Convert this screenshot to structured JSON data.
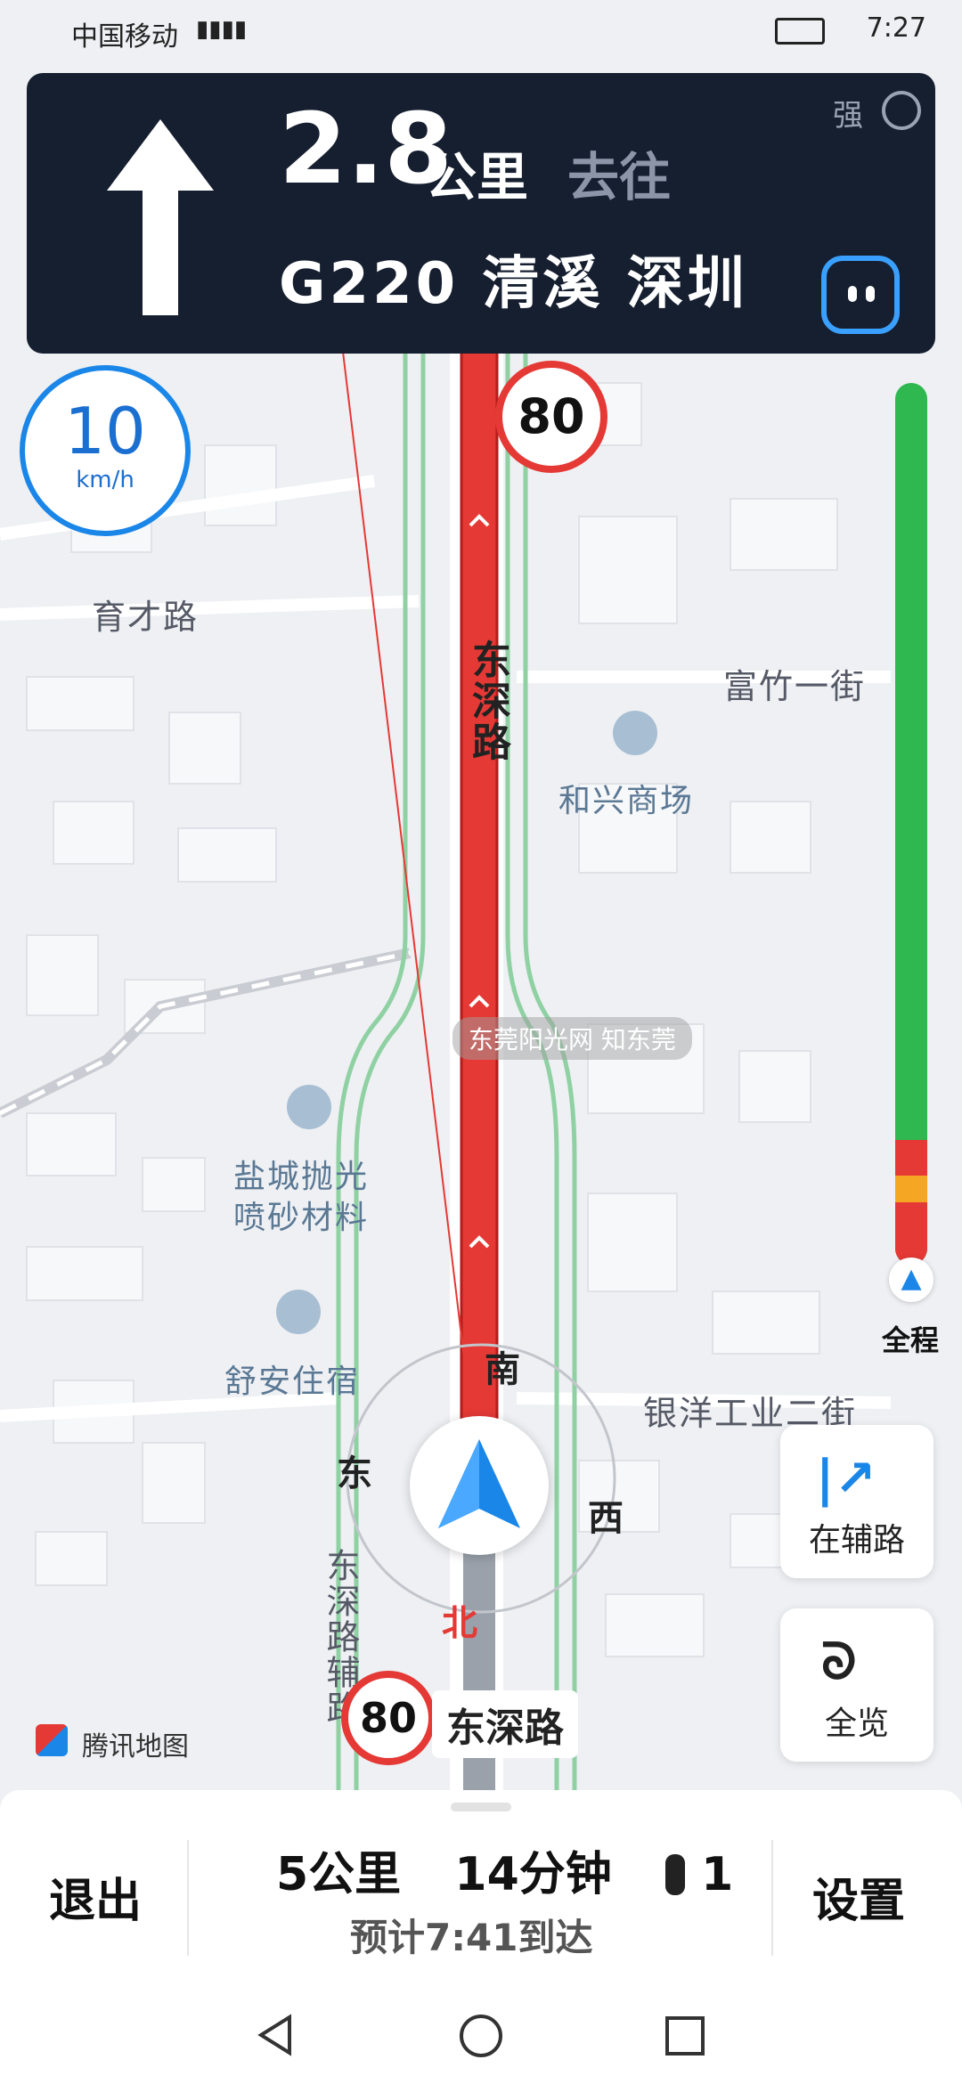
{
  "status_bar": {
    "carrier": "中国移动",
    "time": "7:27"
  },
  "navigation": {
    "distance_value": "2.8",
    "distance_unit": "公里",
    "goto_label": "去往",
    "road_line": "G220  清溪  深圳",
    "signal_label": "强",
    "maneuver_icon": "straight-arrow-icon"
  },
  "speed": {
    "value": "10",
    "unit": "km/h"
  },
  "speed_limits": {
    "top": "80",
    "bottom": "80"
  },
  "current_road": "东深路",
  "map_labels": {
    "yucai_road": "育才路",
    "fuzhu_street": "富竹一街",
    "dongshen_road_vertical": "东深路",
    "hexing_mall": "和兴商场",
    "yancheng_line1": "盐城抛光",
    "yancheng_line2": "喷砂材料",
    "shuan_lodging": "舒安住宿",
    "yinyang_street": "银洋工业二街",
    "dongshen_aux_road": "东深路辅路",
    "map_brand": "腾讯地图",
    "watermark": "东莞阳光网  知东莞"
  },
  "compass": {
    "south": "南",
    "east": "东",
    "west": "西",
    "north": "北"
  },
  "progress": {
    "label": "全程",
    "green_fraction": 0.82
  },
  "side_buttons": {
    "aux_road": "在辅路",
    "overview": "全览"
  },
  "bottom_panel": {
    "exit": "退出",
    "summary": "5公里  14分钟  ⁠🚦1",
    "summary_distance": "5公里",
    "summary_time": "14分钟",
    "traffic_lights": "1",
    "eta": "预计7:41到达",
    "settings": "设置"
  },
  "colors": {
    "card_bg": "#161f30",
    "route_red": "#e53935",
    "progress_green": "#2eb84f",
    "accent_blue": "#1a86e8"
  }
}
